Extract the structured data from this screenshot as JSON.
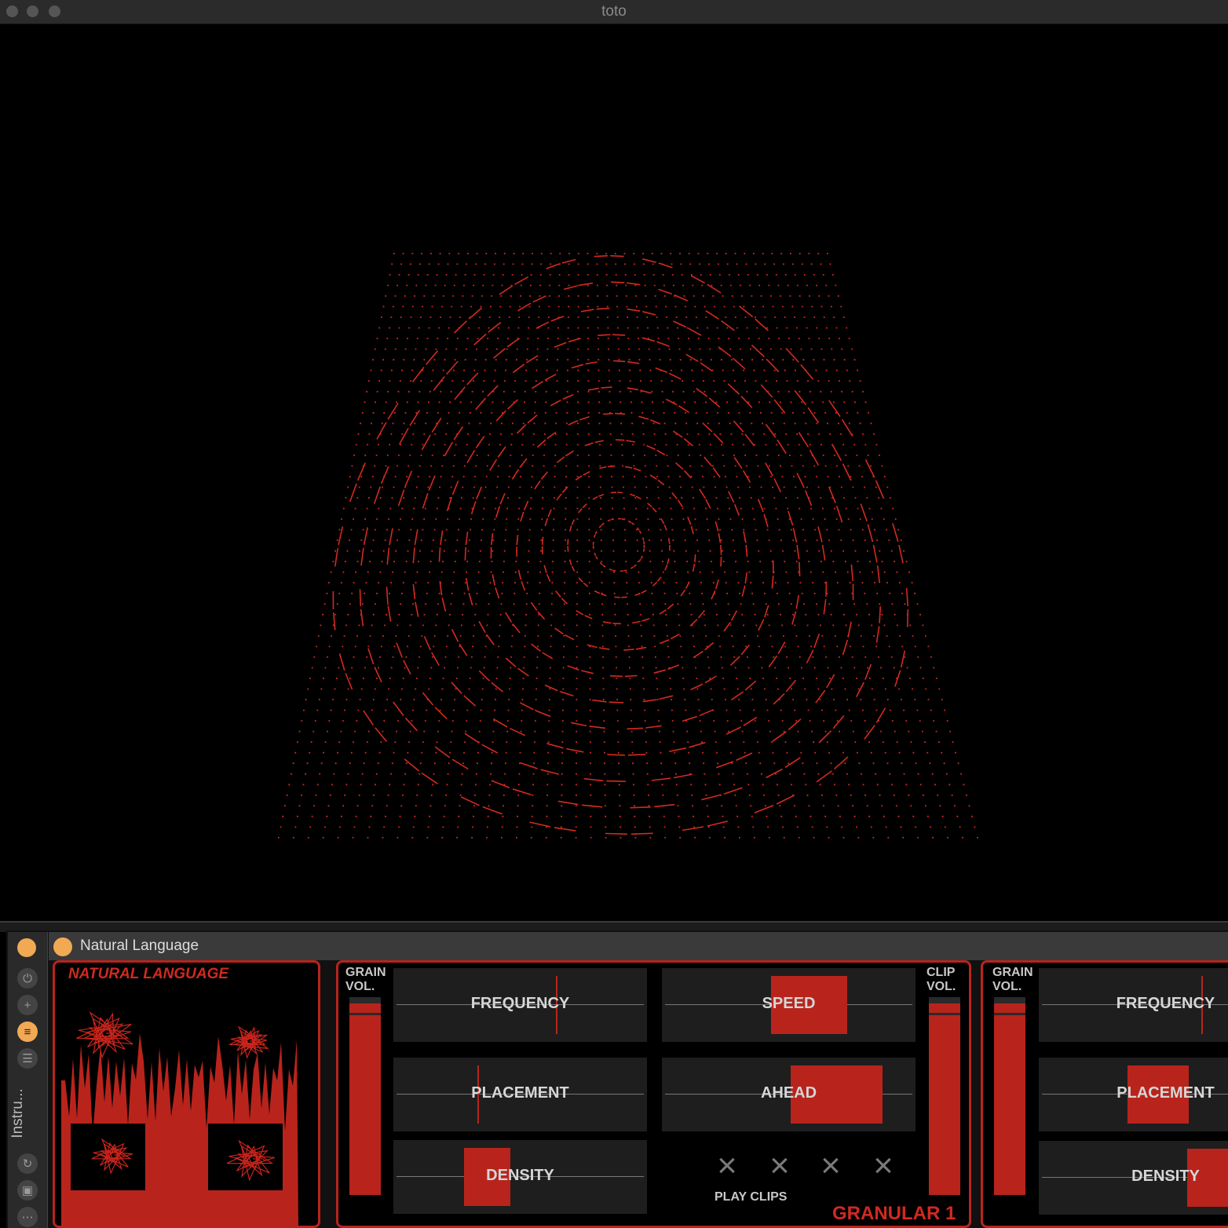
{
  "window": {
    "title": "toto"
  },
  "device": {
    "name": "Natural Language"
  },
  "sidebar": {
    "label": "Instru..."
  },
  "nl_panel": {
    "title": "NATURAL LANGUAGE"
  },
  "granular1": {
    "grain_vol_label": "GRAIN\nVOL.",
    "clip_vol_label": "CLIP\nVOL.",
    "grain_vol": 0.97,
    "clip_vol": 0.97,
    "frequency": {
      "label": "FREQUENCY",
      "value": 0.64
    },
    "placement": {
      "label": "PLACEMENT",
      "value": 0.33
    },
    "density": {
      "label": "DENSITY",
      "value": 0.37
    },
    "speed": {
      "label": "SPEED",
      "value": 0.58
    },
    "ahead": {
      "label": "AHEAD",
      "value": 0.69
    },
    "play_clips_label": "PLAY CLIPS",
    "clip_buttons": [
      "×",
      "×",
      "×",
      "×"
    ],
    "name": "GRANULAR 1"
  },
  "granular2": {
    "grain_vol_label": "GRAIN\nVOL.",
    "grain_vol": 0.97,
    "frequency": {
      "label": "FREQUENCY",
      "value": 0.64
    },
    "placement": {
      "label": "PLACEMENT",
      "value": 0.47
    },
    "density": {
      "label": "DENSITY"
    }
  },
  "colors": {
    "accent": "#b8241c",
    "device_dot": "#f2a954",
    "panel_bg": "#1e1e1e"
  }
}
